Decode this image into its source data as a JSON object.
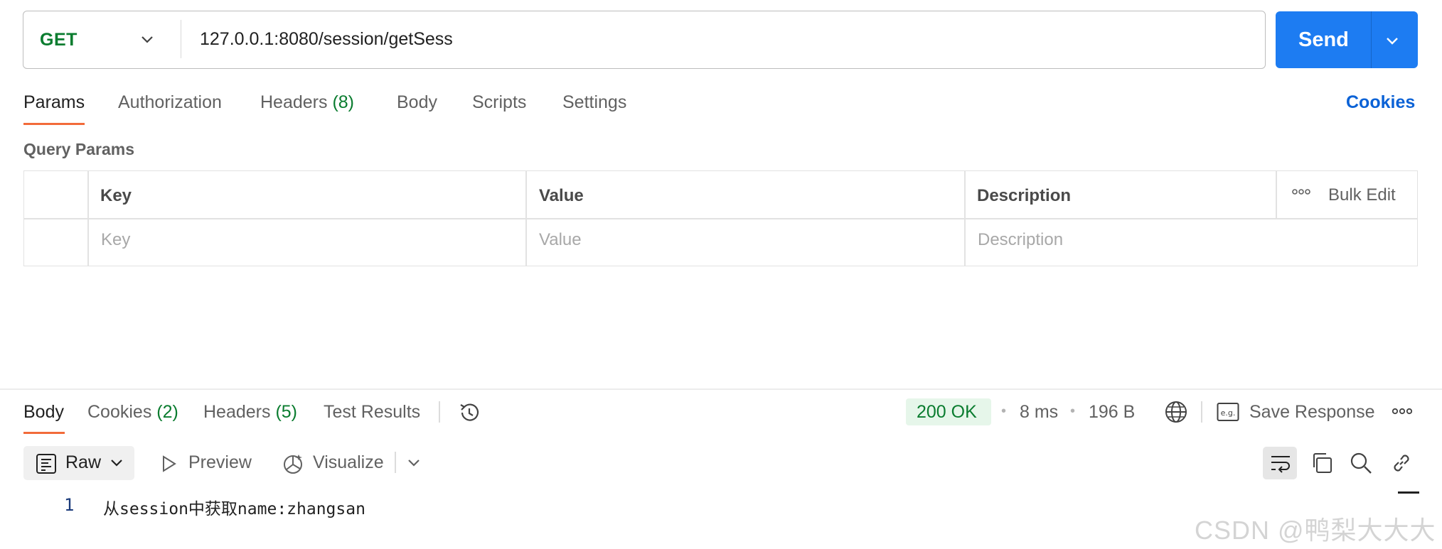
{
  "request": {
    "method": "GET",
    "url": "127.0.0.1:8080/session/getSess",
    "send_label": "Send"
  },
  "request_tabs": [
    {
      "label": "Params",
      "count": ""
    },
    {
      "label": "Authorization",
      "count": ""
    },
    {
      "label": "Headers",
      "count": "(8)"
    },
    {
      "label": "Body",
      "count": ""
    },
    {
      "label": "Scripts",
      "count": ""
    },
    {
      "label": "Settings",
      "count": ""
    }
  ],
  "cookies_link": "Cookies",
  "query_params": {
    "title": "Query Params",
    "columns": [
      "Key",
      "Value",
      "Description"
    ],
    "bulk_edit": "Bulk Edit",
    "placeholders": [
      "Key",
      "Value",
      "Description"
    ]
  },
  "response_tabs": [
    {
      "label": "Body",
      "count": ""
    },
    {
      "label": "Cookies",
      "count": "(2)"
    },
    {
      "label": "Headers",
      "count": "(5)"
    },
    {
      "label": "Test Results",
      "count": ""
    }
  ],
  "response_meta": {
    "status": "200 OK",
    "time": "8 ms",
    "size": "196 B",
    "save_response": "Save Response"
  },
  "body_toolbar": {
    "format": "Raw",
    "preview": "Preview",
    "visualize": "Visualize"
  },
  "response_body": [
    {
      "line": "1",
      "text": "从session中获取name:zhangsan"
    }
  ],
  "watermark": "CSDN @鸭梨大大大",
  "colors": {
    "accent": "#1d7cf2",
    "get_method": "#0a7c2f",
    "active_tab_underline": "#f26b3a",
    "status_ok_bg": "#e6f6ea"
  },
  "icons": [
    "chevron-down-icon",
    "history-icon",
    "globe-icon",
    "save-response-icon",
    "more-icon",
    "raw-doc-icon",
    "play-icon",
    "visualize-icon",
    "wrap-lines-icon",
    "copy-icon",
    "search-icon",
    "link-icon"
  ]
}
